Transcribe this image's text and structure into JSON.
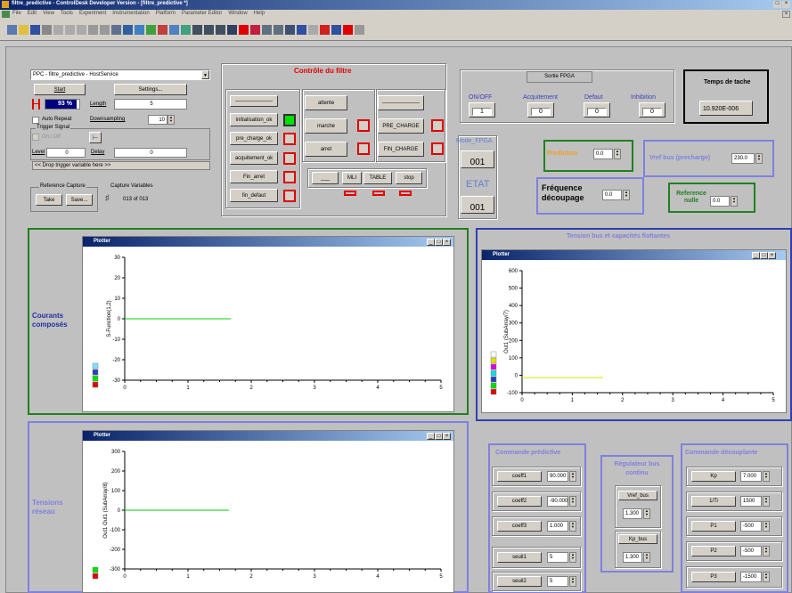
{
  "app": {
    "title": "filtre_predictive - ControlDesk Developer Version - [filtre_predictive *]",
    "menus": [
      "File",
      "Edit",
      "View",
      "Tools",
      "Experiment",
      "Instrumentation",
      "Platform",
      "Parameter Editor",
      "Window",
      "Help"
    ]
  },
  "trigger": {
    "service": "PPC - filtre_predictive - HostService",
    "start": "Start",
    "settings": "Settings...",
    "progress": "93 %",
    "progress_frac": 0.93,
    "length_label": "Length",
    "length": "5",
    "auto_repeat": "Auto Repeat",
    "downsampling_label": "Downsampling",
    "downsampling": "10",
    "trigger_signal": "Trigger Signal",
    "on_off": "On / Off",
    "level_label": "Level",
    "level": "0",
    "delay_label": "Delay",
    "delay": "0",
    "drop_hint": "<< Drop trigger variable here >>",
    "ref_capture": "Reference Capture",
    "take": "Take",
    "save": "Save...",
    "capture_vars": "Capture Variables",
    "capture_count": "013 of 013"
  },
  "controle": {
    "title": "Contrôle du filtre",
    "dash1": "———————",
    "init": "initialisation_ok",
    "pre_charge": "pre_charge_ok",
    "acquit": "acquitement_ok",
    "fin_arret": "Fin_arret",
    "fin_defaut": "fin_defaut",
    "attente": "attente",
    "marche": "marche",
    "arret": "arret",
    "dash2": "———————",
    "pre_charge_btn": "PRE_CHARGE",
    "fin_charge": "FIN_CHARGE",
    "dash3": "___",
    "mli": "MLI",
    "table": "TABLE",
    "stop": "stop"
  },
  "sortie": {
    "title": "Sortie FPGA",
    "onoff": "ON/OFF",
    "acquit": "Acquitement",
    "defaut": "Defaut",
    "inhibition": "Inhibition",
    "v_onoff": "1",
    "v_acquit": "0",
    "v_defaut": "0",
    "v_inhib": "0"
  },
  "tache": {
    "title": "Temps de tache",
    "value": "10.920E-006"
  },
  "fpga": {
    "mode_label": "Mode_FPGA",
    "mode": "001",
    "etat_label": "ETAT",
    "etat": "001"
  },
  "prediction": {
    "label": "Prediction",
    "value": "0.0"
  },
  "vref": {
    "label": "Vref bus (precharge)",
    "value": "230.0"
  },
  "freq": {
    "label": "Fréquence découpage",
    "value": "0.0"
  },
  "refnulle": {
    "label": "Reference nulle",
    "value": "0.0"
  },
  "section_labels": {
    "courants": "Courants composés",
    "tensions_reseau": "Tensions réseau",
    "tension_bus": "Tension bus et capacités flottantes"
  },
  "plot1": {
    "title": "Plotter",
    "ylabel": "S-Function(1,2)",
    "yticks": [
      "30",
      "20",
      "10",
      "0",
      "-10",
      "-20",
      "-30"
    ],
    "xticks": [
      "0",
      "1",
      "2",
      "3",
      "4",
      "5"
    ]
  },
  "plot2": {
    "title": "Plotter",
    "ylabel": "Out1 (SubArray/7)",
    "yticks": [
      "600",
      "500",
      "400",
      "300",
      "200",
      "100",
      "0",
      "-100"
    ],
    "xticks": [
      "0",
      "1",
      "2",
      "3",
      "4",
      "5"
    ]
  },
  "plot3": {
    "title": "Plotter",
    "ylabel": "Out1 Out1 (SubArray/8)",
    "yticks": [
      "300",
      "200",
      "100",
      "0",
      "-100",
      "-200",
      "-300"
    ],
    "xticks": [
      "0",
      "1",
      "2",
      "3",
      "4",
      "5"
    ]
  },
  "cmd_pred": {
    "title": "Commande prédictive",
    "coeff1": "coeff1",
    "coeff2": "coeff2",
    "coeff3": "coeff3",
    "v1": "90.000",
    "v2": "-90.000",
    "v3": "1.000",
    "seuil1": "seuil1",
    "seuil2": "seuil2",
    "s1": "5",
    "s2": "5"
  },
  "regulateur": {
    "title": "Régulateur bus continu",
    "vref": "Vref_bus",
    "v_vref": "1.300",
    "kp": "Kp_bus",
    "v_kp": "1.300"
  },
  "cmd_dec": {
    "title": "Commande découplante",
    "kp": "Kp",
    "ti": "1/Ti",
    "p1": "P1",
    "p2": "P2",
    "p3": "P3",
    "v_kp": "7.000",
    "v_ti": "1500",
    "v_p1": "-500",
    "v_p2": "-500",
    "v_p3": "-1500"
  },
  "colors": {
    "accent_red": "#e00000",
    "lamp_green": "#00e000",
    "title_blue": "#0a246a",
    "plot_green": "#00d000",
    "plot_yellow": "#e0e000"
  }
}
